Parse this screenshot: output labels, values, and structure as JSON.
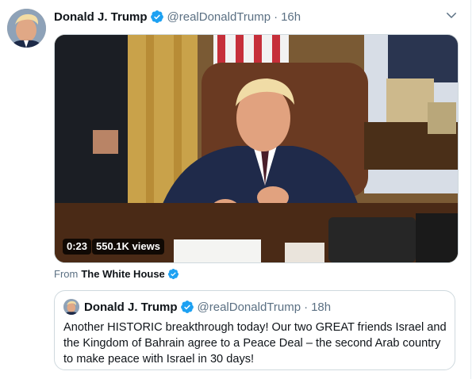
{
  "tweet": {
    "display_name": "Donald J. Trump",
    "handle": "@realDonaldTrump",
    "separator": "·",
    "timestamp": "16h",
    "verified_icon": "verified-badge-icon",
    "menu_icon": "chevron-down-icon"
  },
  "video": {
    "duration": "0:23",
    "views": "550.1K views"
  },
  "source": {
    "from_label": "From",
    "name": "The White House"
  },
  "quoted_tweet": {
    "display_name": "Donald J. Trump",
    "handle": "@realDonaldTrump",
    "separator": "·",
    "timestamp": "18h",
    "text": "Another HISTORIC breakthrough today! Our two GREAT friends Israel and the Kingdom of Bahrain agree to a Peace Deal – the second Arab country to make peace with Israel in 30 days!"
  },
  "colors": {
    "verified_blue": "#1da1f2",
    "secondary_text": "#5b7083",
    "border": "#cfd9de"
  }
}
